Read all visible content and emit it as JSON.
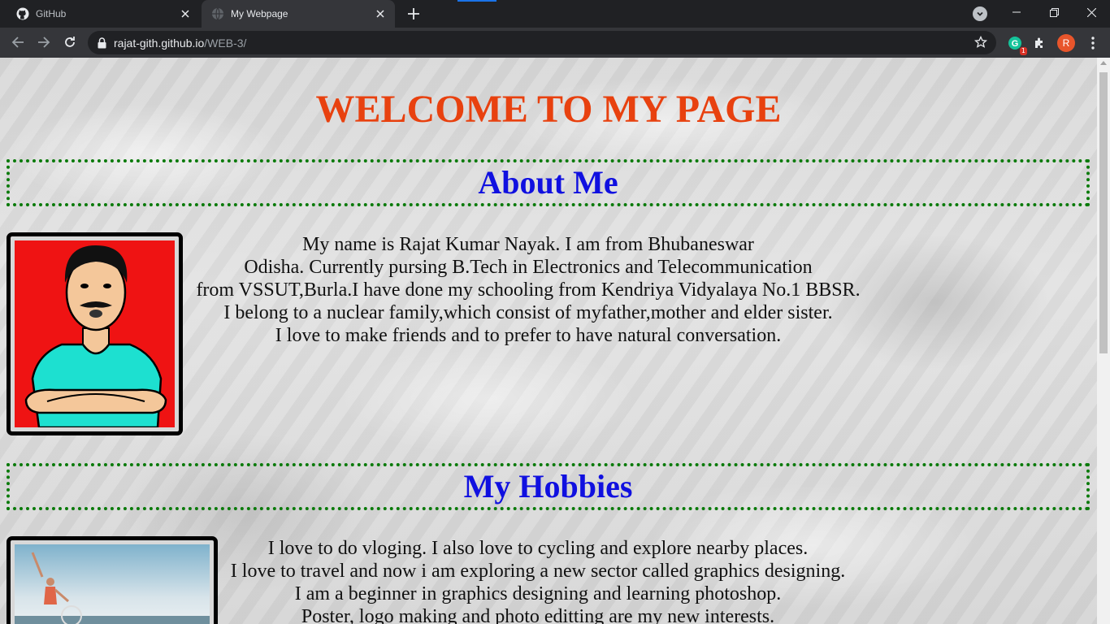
{
  "browser": {
    "tabs": [
      {
        "title": "GitHub",
        "icon": "github-icon",
        "active": false
      },
      {
        "title": "My Webpage",
        "icon": "globe-icon",
        "active": true
      }
    ],
    "url_host": "rajat-gith.github.io",
    "url_path": "/WEB-3/",
    "grammarly_badge": "1",
    "profile_initial": "R",
    "accent_color": "#1a73e8"
  },
  "page": {
    "title": "WELCOME TO MY PAGE",
    "title_color": "#e8410f",
    "heading_color": "#1010e0",
    "border_color": "#0a7a0a",
    "about": {
      "heading": "About Me",
      "lines": [
        "My name is Rajat Kumar Nayak. I am from Bhubaneswar",
        "Odisha. Currently pursing B.Tech in Electronics and Telecommunication",
        "from VSSUT,Burla.I have done my schooling from Kendriya Vidyalaya No.1 BBSR.",
        "I belong to a nuclear family,which consist of myfather,mother and elder sister.",
        "I love to make friends and to prefer to have natural conversation."
      ]
    },
    "hobbies": {
      "heading": "My Hobbies",
      "lines": [
        "I love to do vloging. I also love to cycling and explore nearby places.",
        "I love to travel and now i am exploring a new sector called graphics designing.",
        "I am a beginner in graphics designing and learning photoshop.",
        "Poster, logo making and photo editting are my new interests."
      ]
    }
  }
}
